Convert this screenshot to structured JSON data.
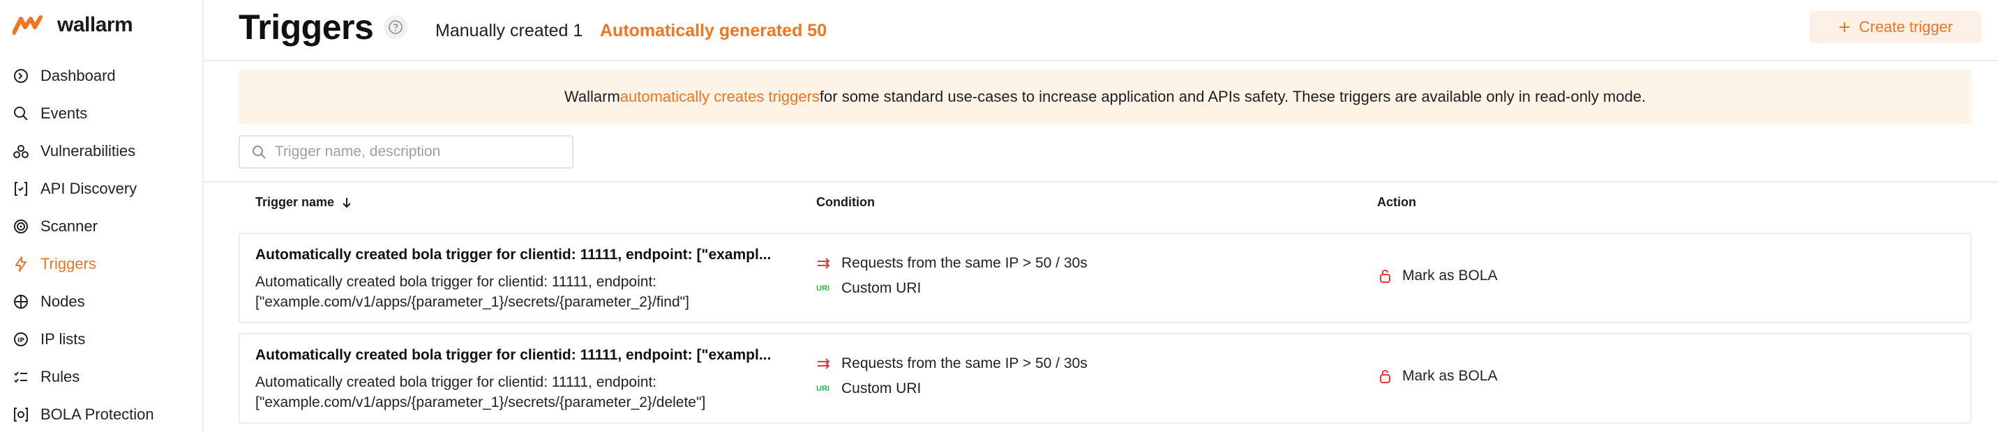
{
  "brand": {
    "name": "wallarm",
    "accent": "#f27420"
  },
  "sidebar": {
    "items": [
      {
        "label": "Dashboard",
        "icon": "dashboard-icon",
        "active": false
      },
      {
        "label": "Events",
        "icon": "search-icon",
        "active": false
      },
      {
        "label": "Vulnerabilities",
        "icon": "biohazard-icon",
        "active": false
      },
      {
        "label": "API Discovery",
        "icon": "api-discovery-icon",
        "active": false
      },
      {
        "label": "Scanner",
        "icon": "scanner-icon",
        "active": false
      },
      {
        "label": "Triggers",
        "icon": "lightning-icon",
        "active": true
      },
      {
        "label": "Nodes",
        "icon": "nodes-icon",
        "active": false
      },
      {
        "label": "IP lists",
        "icon": "ip-icon",
        "active": false
      },
      {
        "label": "Rules",
        "icon": "rules-icon",
        "active": false
      },
      {
        "label": "BOLA Protection",
        "icon": "bola-icon",
        "active": false
      }
    ]
  },
  "header": {
    "title": "Triggers",
    "tabs": [
      {
        "label": "Manually created 1",
        "active": false
      },
      {
        "label": "Automatically generated 50",
        "active": true
      }
    ],
    "create_button": "Create trigger"
  },
  "banner": {
    "before": "Wallarm ",
    "link": "automatically creates triggers",
    "after": " for some standard use-cases to increase application and APIs safety. These triggers are available only in read-only mode."
  },
  "search": {
    "placeholder": "Trigger name, description",
    "value": ""
  },
  "table": {
    "columns": {
      "name": "Trigger name",
      "condition": "Condition",
      "action": "Action"
    },
    "rows": [
      {
        "title": "Automatically created bola trigger for clientid: 11111, endpoint: [\"exampl...",
        "description": "Automatically created bola trigger for clientid: 11111, endpoint: [\"example.com/v1/apps/{parameter_1}/secrets/{parameter_2}/find\"]",
        "conditions": [
          "Requests from the same IP > 50 / 30s",
          "Custom URI"
        ],
        "uri_badge": "URI",
        "action": "Mark as BOLA"
      },
      {
        "title": "Automatically created bola trigger for clientid: 11111, endpoint: [\"exampl...",
        "description": "Automatically created bola trigger for clientid: 11111, endpoint: [\"example.com/v1/apps/{parameter_1}/secrets/{parameter_2}/delete\"]",
        "conditions": [
          "Requests from the same IP > 50 / 30s",
          "Custom URI"
        ],
        "uri_badge": "URI",
        "action": "Mark as BOLA"
      }
    ]
  }
}
